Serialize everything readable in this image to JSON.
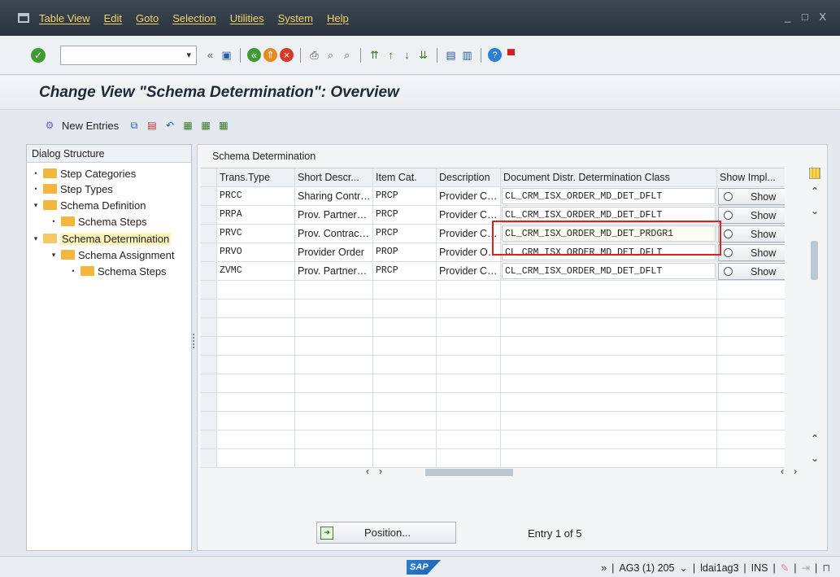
{
  "menubar": {
    "items": [
      "Table View",
      "Edit",
      "Goto",
      "Selection",
      "Utilities",
      "System",
      "Help"
    ],
    "window_controls": "_ □ X"
  },
  "toolbar": {
    "command_field_value": "",
    "icons": [
      "check-icon",
      "history-icon",
      "save-icon",
      "back-icon",
      "exit-icon",
      "cancel-icon",
      "print-icon",
      "find-icon",
      "find-next-icon",
      "first-page-icon",
      "prev-page-icon",
      "next-page-icon",
      "last-page-icon",
      "new-session-icon",
      "shortcut-icon",
      "help-icon",
      "layout-icon"
    ]
  },
  "title": "Change View \"Schema Determination\": Overview",
  "app_toolbar": {
    "new_entries": "New Entries"
  },
  "dialog_structure": {
    "header": "Dialog Structure",
    "nodes": [
      {
        "label": "Step Categories",
        "level": 0,
        "toggle": "•",
        "open": false,
        "selected": false
      },
      {
        "label": "Step Types",
        "level": 0,
        "toggle": "•",
        "open": false,
        "selected": false
      },
      {
        "label": "Schema Definition",
        "level": 0,
        "toggle": "▾",
        "open": false,
        "selected": false
      },
      {
        "label": "Schema Steps",
        "level": 1,
        "toggle": "•",
        "open": false,
        "selected": false
      },
      {
        "label": "Schema Determination",
        "level": 0,
        "toggle": "▾",
        "open": true,
        "selected": true
      },
      {
        "label": "Schema Assignment",
        "level": 1,
        "toggle": "▾",
        "open": false,
        "selected": false
      },
      {
        "label": "Schema Steps",
        "level": 2,
        "toggle": "•",
        "open": false,
        "selected": false
      }
    ]
  },
  "table": {
    "title": "Schema Determination",
    "headers": [
      "Trans.Type",
      "Short Descr...",
      "Item Cat.",
      "Description",
      "Document Distr. Determination Class",
      "Show Impl..."
    ],
    "rows": [
      {
        "trans_type": "PRCC",
        "short_descr": "Sharing Contr…",
        "item_cat": "PRCP",
        "description": "Provider C…",
        "class": "CL_CRM_ISX_ORDER_MD_DET_DFLT",
        "show": "Show"
      },
      {
        "trans_type": "PRPA",
        "short_descr": "Prov. Partner…",
        "item_cat": "PRCP",
        "description": "Provider C…",
        "class": "CL_CRM_ISX_ORDER_MD_DET_DFLT",
        "show": "Show"
      },
      {
        "trans_type": "PRVC",
        "short_descr": "Prov. Contrac…",
        "item_cat": "PRCP",
        "description": "Provider C…",
        "class": "CL_CRM_ISX_ORDER_MD_DET_PRDGR1",
        "show": "Show"
      },
      {
        "trans_type": "PRVO",
        "short_descr": "Provider Order",
        "item_cat": "PROP",
        "description": "Provider O…",
        "class": "CL_CRM_ISX_ORDER_MD_DET_DFLT",
        "show": "Show"
      },
      {
        "trans_type": "ZVMC",
        "short_descr": "Prov. Partner…",
        "item_cat": "PRCP",
        "description": "Provider C…",
        "class": "CL_CRM_ISX_ORDER_MD_DET_DFLT",
        "show": "Show"
      }
    ],
    "empty_rows": 10
  },
  "footer": {
    "position_button": "Position...",
    "entry_info": "Entry 1 of 5"
  },
  "statusbar": {
    "logo": "SAP",
    "system": "AG3 (1) 205",
    "user": "ldai1ag3",
    "mode": "INS"
  }
}
